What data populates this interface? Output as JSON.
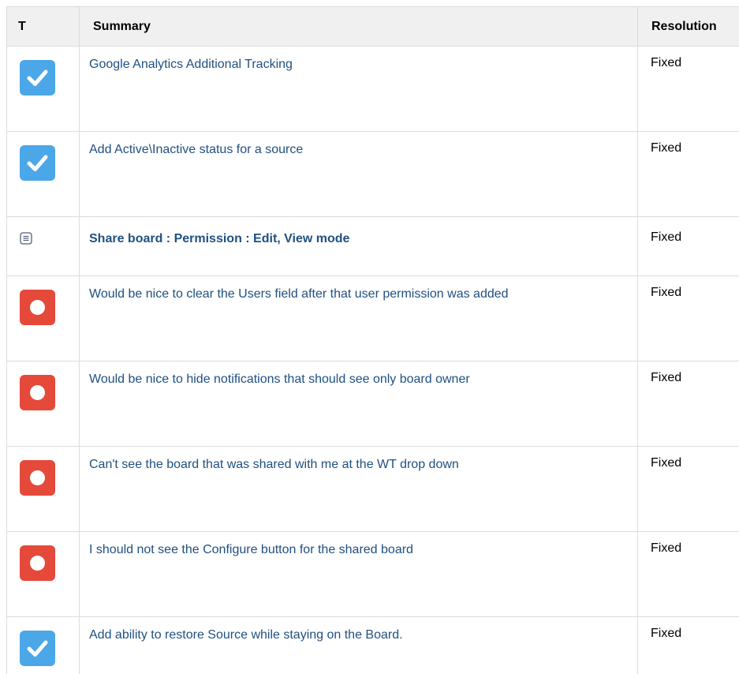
{
  "table": {
    "headers": {
      "type": "T",
      "summary": "Summary",
      "resolution": "Resolution"
    },
    "rows": [
      {
        "type_icon": "story-check-icon",
        "summary": "Google Analytics Additional Tracking",
        "resolution": "Fixed"
      },
      {
        "type_icon": "story-check-icon",
        "summary": "Add Active\\Inactive status for a source",
        "resolution": "Fixed"
      },
      {
        "type_icon": "document-icon",
        "summary": "Share board : Permission : Edit, View mode",
        "resolution": "Fixed"
      },
      {
        "type_icon": "bug-icon",
        "summary": "Would be nice to clear the Users field after that user permission was added",
        "resolution": "Fixed"
      },
      {
        "type_icon": "bug-icon",
        "summary": "Would be nice to hide notifications that should see only board owner",
        "resolution": "Fixed"
      },
      {
        "type_icon": "bug-icon",
        "summary": "Can't see the board that was shared with me at the WT drop down",
        "resolution": "Fixed"
      },
      {
        "type_icon": "bug-icon",
        "summary": "I should not see the Configure button for the shared board",
        "resolution": "Fixed"
      },
      {
        "type_icon": "story-check-icon",
        "summary": "Add ability to restore Source while staying on the Board.",
        "resolution": "Fixed"
      }
    ]
  },
  "colors": {
    "link": "#205081",
    "story_icon_bg": "#4ba7e8",
    "bug_icon_bg": "#e5493a",
    "header_bg": "#f0f0f0",
    "border": "#dcdcdc"
  }
}
